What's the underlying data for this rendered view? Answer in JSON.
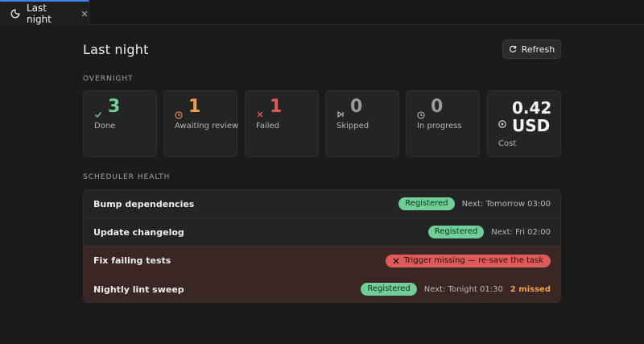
{
  "tab": {
    "label": "Last night",
    "close": "×"
  },
  "page": {
    "title": "Last night",
    "refresh_label": "Refresh"
  },
  "overnight": {
    "label": "OVERNIGHT",
    "cards": [
      {
        "key": "done",
        "value": "3",
        "caption": "Done",
        "color": "#6fcf97",
        "icon": "check-icon"
      },
      {
        "key": "awaiting",
        "value": "1",
        "caption": "Awaiting review",
        "color": "#f0a04b",
        "icon": "clock-icon"
      },
      {
        "key": "failed",
        "value": "1",
        "caption": "Failed",
        "color": "#e05a5a",
        "icon": "x-icon"
      },
      {
        "key": "skipped",
        "value": "0",
        "caption": "Skipped",
        "color": "#9a9a9a",
        "icon": "skip-icon"
      },
      {
        "key": "progress",
        "value": "0",
        "caption": "In progress",
        "color": "#9a9a9a",
        "icon": "clock-icon"
      }
    ],
    "cost": {
      "value_line1": "0.42",
      "value_line2": "USD",
      "caption": "Cost",
      "icon": "play-circle-icon"
    }
  },
  "health": {
    "label": "SCHEDULER HEALTH",
    "rows": [
      {
        "name": "Bump dependencies",
        "badge": "Registered",
        "next": "Next: Tomorrow 03:00"
      },
      {
        "name": "Update changelog",
        "badge": "Registered",
        "next": "Next: Fri 02:00"
      },
      {
        "name": "Fix failing tests",
        "error": "Trigger missing — re-save the task"
      },
      {
        "name": "Nightly lint sweep",
        "badge": "Registered",
        "next": "Next: Tonight 01:30",
        "missed": "2 missed"
      }
    ]
  },
  "colors": {
    "accent": "#3b82f6",
    "success": "#6fcf97",
    "warning": "#f0a04b",
    "danger": "#e05a5a"
  }
}
